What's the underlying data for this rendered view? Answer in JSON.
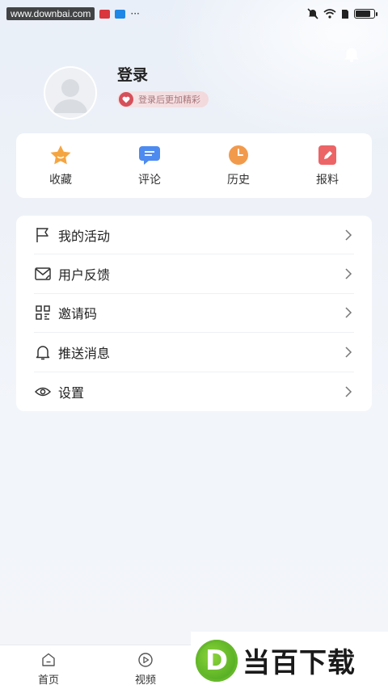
{
  "status_bar": {
    "watermark": "www.downbai.com",
    "more": "···",
    "colors": {
      "red": "#d9363e",
      "blue": "#1f87e5"
    }
  },
  "profile": {
    "login_title": "登录",
    "login_hint": "登录后更加精彩"
  },
  "quick_actions": [
    {
      "label": "收藏",
      "icon": "star-icon",
      "color": "#f5a540"
    },
    {
      "label": "评论",
      "icon": "comment-icon",
      "color": "#4e8bf0"
    },
    {
      "label": "历史",
      "icon": "clock-icon",
      "color": "#f29a4c"
    },
    {
      "label": "报料",
      "icon": "pencil-icon",
      "color": "#ec6466"
    }
  ],
  "menu": [
    {
      "label": "我的活动",
      "icon": "flag-icon"
    },
    {
      "label": "用户反馈",
      "icon": "mail-icon"
    },
    {
      "label": "邀请码",
      "icon": "grid-icon"
    },
    {
      "label": "推送消息",
      "icon": "bell-icon"
    },
    {
      "label": "设置",
      "icon": "eye-icon"
    }
  ],
  "bottom_nav": [
    {
      "label": "首页",
      "icon": "home-icon"
    },
    {
      "label": "视频",
      "icon": "play-icon"
    }
  ],
  "brand": {
    "logo_letter": "D",
    "name": "当百下载"
  }
}
